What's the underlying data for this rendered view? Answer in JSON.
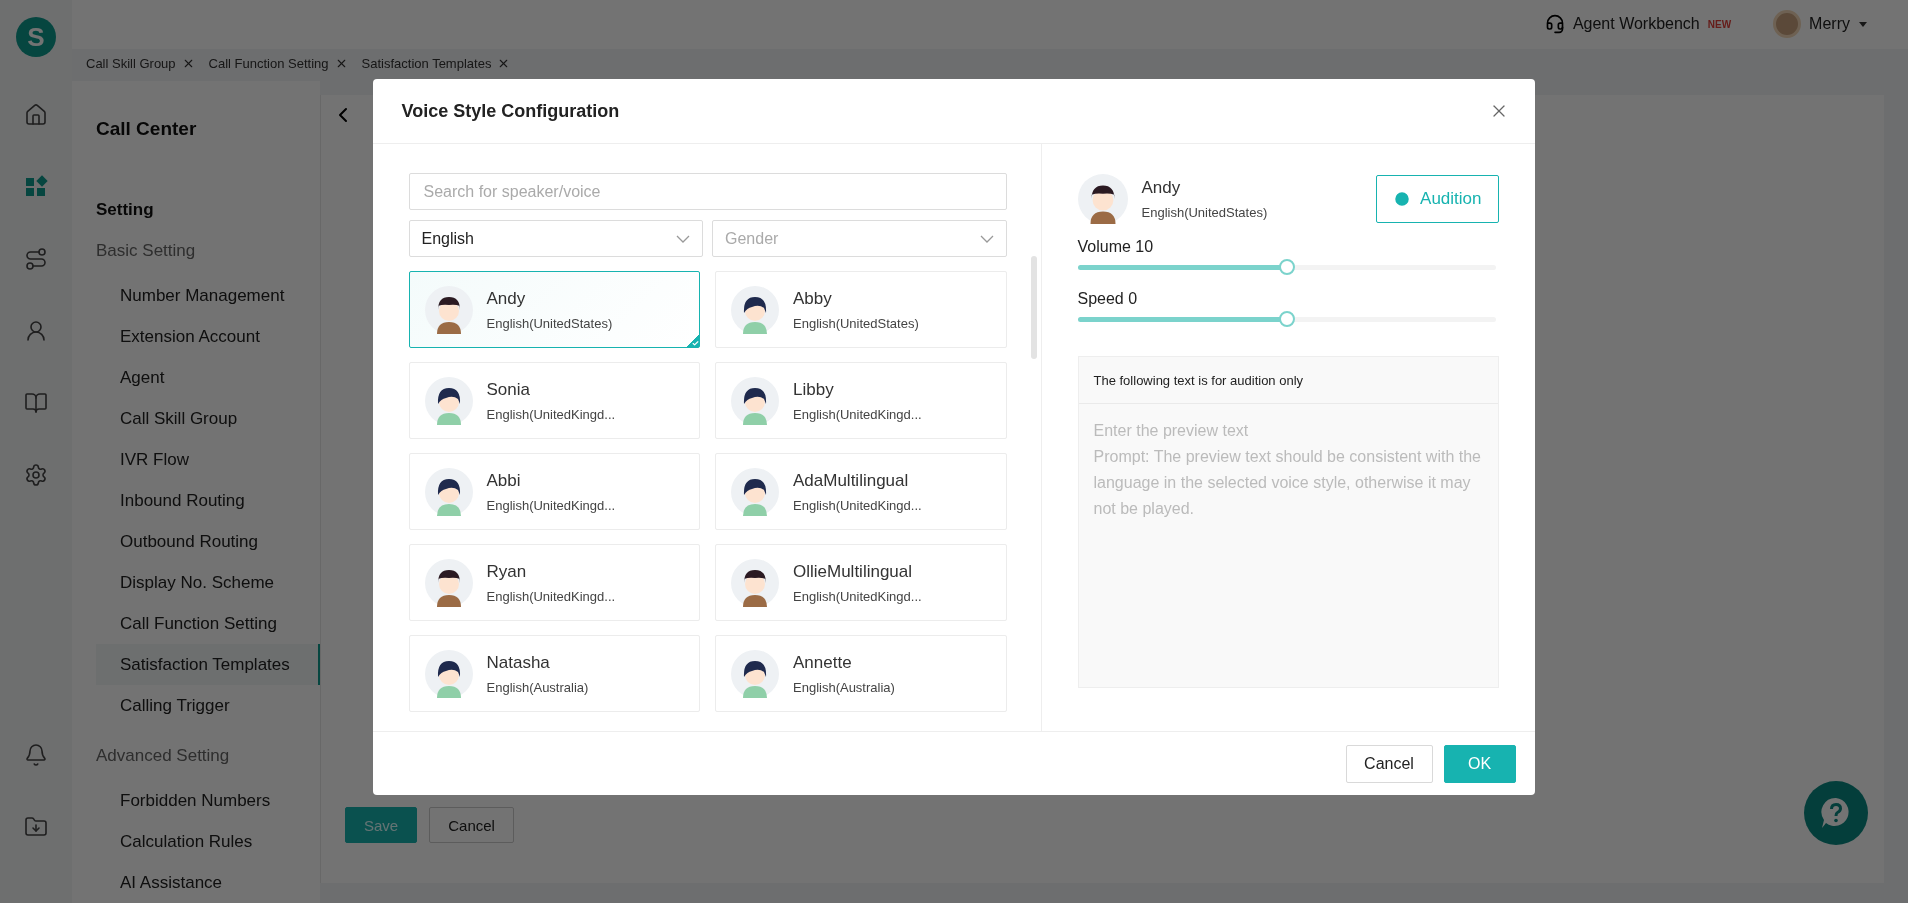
{
  "app": {
    "logo": "S"
  },
  "rail": [
    {
      "kind": "home",
      "selected": false
    },
    {
      "kind": "apps",
      "selected": true
    },
    {
      "kind": "route",
      "selected": false
    },
    {
      "kind": "person",
      "selected": false
    },
    {
      "kind": "book",
      "selected": false
    },
    {
      "kind": "gear",
      "selected": false
    },
    {
      "kind": "bell",
      "selected": false
    },
    {
      "kind": "download",
      "selected": false
    }
  ],
  "header": {
    "workbench": "Agent Workbench",
    "badge": "NEW",
    "user": "Merry"
  },
  "tabs": [
    {
      "label": "Call Skill Group"
    },
    {
      "label": "Call Function Setting"
    },
    {
      "label": "Satisfaction Templates"
    }
  ],
  "sidebar": {
    "title": "Call Center",
    "section": "Setting",
    "groups": [
      {
        "label": "Basic Setting",
        "items": [
          {
            "label": "Number Management",
            "selected": false
          },
          {
            "label": "Extension Account",
            "selected": false
          },
          {
            "label": "Agent",
            "selected": false
          },
          {
            "label": "Call Skill Group",
            "selected": false
          },
          {
            "label": "IVR Flow",
            "selected": false
          },
          {
            "label": "Inbound Routing",
            "selected": false
          },
          {
            "label": "Outbound Routing",
            "selected": false
          },
          {
            "label": "Display No. Scheme",
            "selected": false
          },
          {
            "label": "Call Function Setting",
            "selected": false
          },
          {
            "label": "Satisfaction Templates",
            "selected": true
          },
          {
            "label": "Calling Trigger",
            "selected": false
          }
        ]
      },
      {
        "label": "Advanced Setting",
        "items": [
          {
            "label": "Forbidden Numbers",
            "selected": false
          },
          {
            "label": "Calculation Rules",
            "selected": false
          },
          {
            "label": "AI Assistance",
            "selected": false
          }
        ]
      }
    ]
  },
  "page": {
    "save": "Save",
    "cancel": "Cancel"
  },
  "modal": {
    "title": "Voice Style Configuration",
    "search": {
      "placeholder": "Search for speaker/voice"
    },
    "language": {
      "value": "English"
    },
    "gender": {
      "placeholder": "Gender"
    },
    "voices": [
      {
        "name": "Andy",
        "locale": "English(UnitedStates)",
        "kind": "boy",
        "selected": true
      },
      {
        "name": "Abby",
        "locale": "English(UnitedStates)",
        "kind": "girl",
        "selected": false
      },
      {
        "name": "Sonia",
        "locale": "English(UnitedKingd...",
        "kind": "girl",
        "selected": false
      },
      {
        "name": "Libby",
        "locale": "English(UnitedKingd...",
        "kind": "girl",
        "selected": false
      },
      {
        "name": "Abbi",
        "locale": "English(UnitedKingd...",
        "kind": "girl",
        "selected": false
      },
      {
        "name": "AdaMultilingual",
        "locale": "English(UnitedKingd...",
        "kind": "girl",
        "selected": false
      },
      {
        "name": "Ryan",
        "locale": "English(UnitedKingd...",
        "kind": "boy",
        "selected": false
      },
      {
        "name": "OllieMultilingual",
        "locale": "English(UnitedKingd...",
        "kind": "boy",
        "selected": false
      },
      {
        "name": "Natasha",
        "locale": "English(Australia)",
        "kind": "girl",
        "selected": false
      },
      {
        "name": "Annette",
        "locale": "English(Australia)",
        "kind": "girl",
        "selected": false
      }
    ],
    "current": {
      "name": "Andy",
      "locale": "English(UnitedStates)",
      "kind": "boy"
    },
    "audition": "Audition",
    "sliders": [
      {
        "label": "Volume 10",
        "level": 0.5
      },
      {
        "label": "Speed 0",
        "level": 0.5
      }
    ],
    "preview": {
      "header": "The following text is for audition only",
      "placeholder": "Enter the preview text\nPrompt: The preview text should be consistent with the language in the selected voice style, otherwise it may not be played."
    },
    "cancel": "Cancel",
    "ok": "OK"
  }
}
